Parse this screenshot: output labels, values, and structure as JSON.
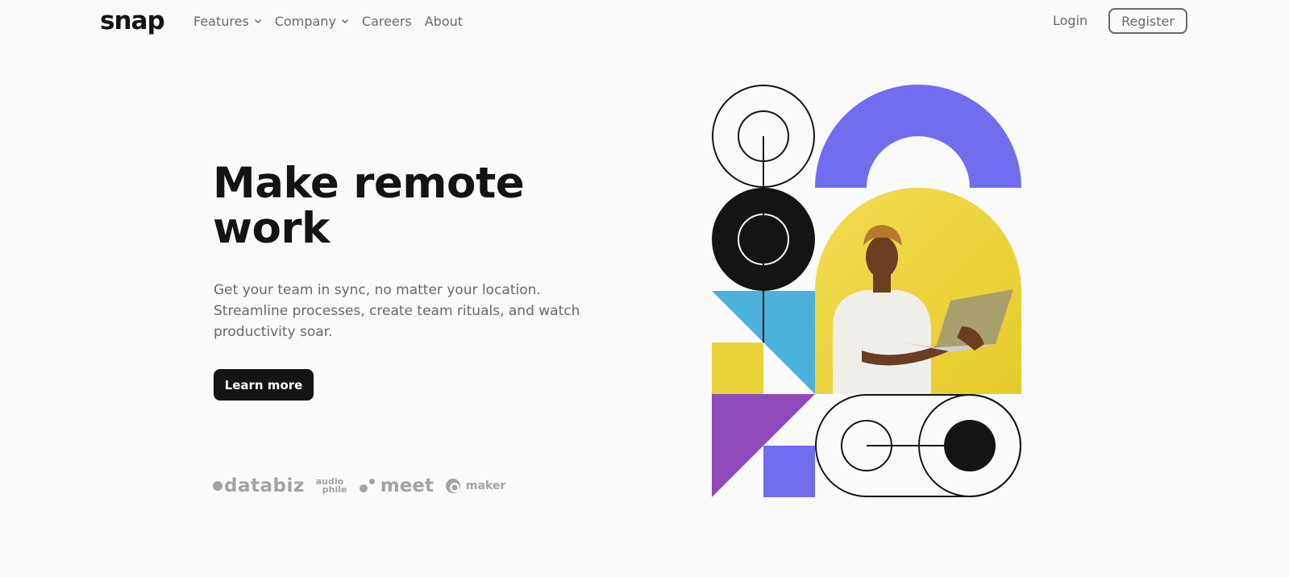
{
  "brand": {
    "logo": "snap"
  },
  "nav": {
    "items": [
      {
        "label": "Features",
        "has_dropdown": true,
        "icon": "chevron-down-icon"
      },
      {
        "label": "Company",
        "has_dropdown": true,
        "icon": "chevron-down-icon"
      },
      {
        "label": "Careers",
        "has_dropdown": false
      },
      {
        "label": "About",
        "has_dropdown": false
      }
    ],
    "login_label": "Login",
    "register_label": "Register"
  },
  "hero": {
    "title_line1": "Make remote",
    "title_line2": "work",
    "description": "Get your team in sync, no matter your location. Streamline processes, create team rituals, and watch productivity soar.",
    "cta_label": "Learn more"
  },
  "clients": [
    {
      "name": "databiz",
      "icon": "databiz-logo"
    },
    {
      "name_top": "audio",
      "name_bottom": "phile",
      "icon": "audiophile-logo"
    },
    {
      "name": "meet",
      "icon": "meet-logo"
    },
    {
      "name": "maker",
      "icon": "maker-logo"
    }
  ],
  "illustration": {
    "description_icon": "hero-illustration",
    "photo_icon": "person-with-laptop-image"
  },
  "colors": {
    "background": "#fafafa",
    "text_dark": "#141414",
    "text_medium": "#696969",
    "text_light": "#a3a3a3",
    "accent_purple": "#726cee",
    "accent_yellow": "#e9d33b",
    "accent_blue": "#4cb1dc",
    "accent_violet": "#8f4bbb"
  }
}
